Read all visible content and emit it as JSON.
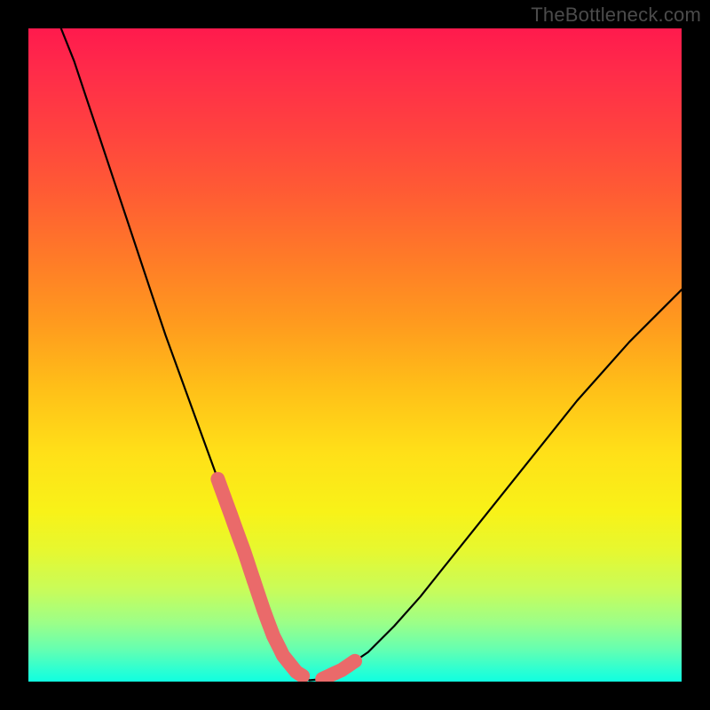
{
  "watermark": "TheBottleneck.com",
  "chart_data": {
    "type": "line",
    "title": "",
    "xlabel": "",
    "ylabel": "",
    "xlim": [
      0,
      100
    ],
    "ylim": [
      0,
      100
    ],
    "x": [
      5,
      7,
      9,
      11,
      13,
      15,
      17,
      19,
      21,
      23,
      25,
      27,
      29,
      31,
      33,
      34.5,
      36,
      37.5,
      39,
      41,
      43,
      45,
      48,
      52,
      56,
      60,
      64,
      68,
      72,
      76,
      80,
      84,
      88,
      92,
      96,
      100
    ],
    "values": [
      100,
      95,
      89,
      83,
      77,
      71,
      65,
      59,
      53,
      47.5,
      42,
      36.5,
      31,
      25.5,
      20,
      15.5,
      11,
      7,
      4,
      1.5,
      0.2,
      0.4,
      1.8,
      4.5,
      8.5,
      13,
      18,
      23,
      28,
      33,
      38,
      43,
      47.5,
      52,
      56,
      60
    ],
    "highlighted_segments": [
      {
        "x_range": [
          29,
          34.5
        ],
        "side": "left"
      },
      {
        "x_range": [
          34.5,
          42
        ],
        "side": "bottom"
      },
      {
        "x_range": [
          45,
          50
        ],
        "side": "right"
      }
    ],
    "highlight_color": "#ea6a6a"
  }
}
